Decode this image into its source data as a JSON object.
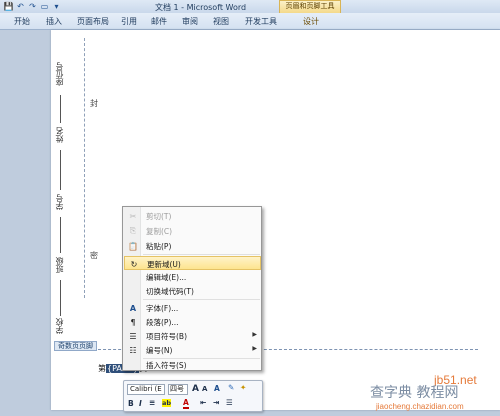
{
  "window": {
    "title": "文档 1 - Microsoft Word",
    "context_tool_title": "页眉和页脚工具"
  },
  "qat": {
    "save": "💾",
    "undo": "↶",
    "redo": "↷",
    "new": "▭",
    "more": "▾"
  },
  "tabs": [
    "开始",
    "插入",
    "页面布局",
    "引用",
    "邮件",
    "审阅",
    "视图",
    "开发工具",
    "设计"
  ],
  "document": {
    "side_labels": [
      "座位号",
      "姓名",
      "学号",
      "班级",
      "学校"
    ],
    "side_chars": [
      "封",
      "密"
    ],
    "footer_tag": "奇数页页脚",
    "footer_prefix": "第",
    "footer_field": "{PAGE}",
    "footer_suffix": "页"
  },
  "context_menu": {
    "items": [
      {
        "label": "剪切(T)",
        "icon": "✂",
        "disabled": true
      },
      {
        "label": "复制(C)",
        "icon": "⎘",
        "disabled": true
      },
      {
        "label": "粘贴(P)",
        "icon": "📋",
        "disabled": false
      },
      {
        "label": "更新域(U)",
        "icon": "↻",
        "disabled": false,
        "highlighted": true
      },
      {
        "label": "编辑域(E)...",
        "icon": "",
        "disabled": false
      },
      {
        "label": "切换域代码(T)",
        "icon": "",
        "disabled": false
      },
      {
        "label": "字体(F)...",
        "icon": "A",
        "disabled": false
      },
      {
        "label": "段落(P)...",
        "icon": "¶",
        "disabled": false
      },
      {
        "label": "项目符号(B)",
        "icon": "☰",
        "disabled": false,
        "submenu": true
      },
      {
        "label": "编号(N)",
        "icon": "☷",
        "disabled": false,
        "submenu": true
      },
      {
        "label": "插入符号(S)",
        "icon": "",
        "disabled": false
      }
    ]
  },
  "mini_toolbar": {
    "font": "Calibri (E",
    "size": "四号",
    "grow": "A",
    "shrink": "A",
    "style": "A",
    "bold": "B",
    "italic": "I",
    "center": "≡",
    "highlight": "ab",
    "color": "A",
    "indent_less": "⇤",
    "indent_more": "⇥",
    "bullets": "☰"
  },
  "watermark": {
    "line1": "jb51.net",
    "line2": "查字典 教程网",
    "line3": "jiaocheng.chazidian.com"
  },
  "colors": {
    "ribbon_bg": "#d4e1f1",
    "context_tab": "#f4d98a",
    "menu_hover": "#fde48f",
    "watermark_orange": "#e57a3a"
  }
}
